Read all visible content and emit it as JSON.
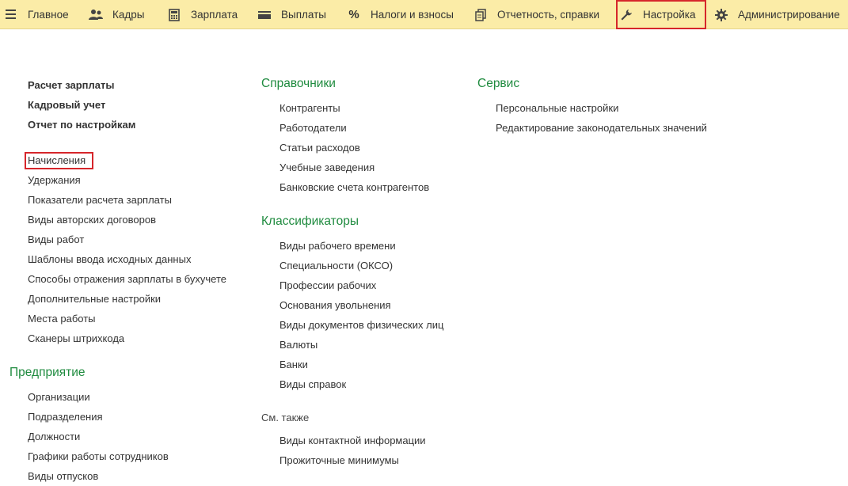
{
  "nav": {
    "items": [
      {
        "label": "Главное",
        "icon": "menu-icon"
      },
      {
        "label": "Кадры",
        "icon": "people-icon"
      },
      {
        "label": "Зарплата",
        "icon": "calculator-icon"
      },
      {
        "label": "Выплаты",
        "icon": "wallet-icon"
      },
      {
        "label": "Налоги и взносы",
        "icon": "percent-icon"
      },
      {
        "label": "Отчетность, справки",
        "icon": "documents-icon"
      },
      {
        "label": "Настройка",
        "icon": "wrench-icon",
        "active": true
      },
      {
        "label": "Администрирование",
        "icon": "gear-icon"
      }
    ]
  },
  "col1": {
    "bold_links": [
      "Расчет зарплаты",
      "Кадровый учет",
      "Отчет по настройкам"
    ],
    "links": [
      "Начисления",
      "Удержания",
      "Показатели расчета зарплаты",
      "Виды авторских договоров",
      "Виды работ",
      "Шаблоны ввода исходных данных",
      "Способы отражения зарплаты в бухучете",
      "Дополнительные настройки",
      "Места работы",
      "Сканеры штрихкода"
    ],
    "enterprise_title": "Предприятие",
    "enterprise_links": [
      "Организации",
      "Подразделения",
      "Должности",
      "Графики работы сотрудников",
      "Виды отпусков"
    ]
  },
  "col2": {
    "references_title": "Справочники",
    "references": [
      "Контрагенты",
      "Работодатели",
      "Статьи расходов",
      "Учебные заведения",
      "Банковские счета контрагентов"
    ],
    "classifiers_title": "Классификаторы",
    "classifiers": [
      "Виды рабочего времени",
      "Специальности (ОКСО)",
      "Профессии рабочих",
      "Основания увольнения",
      "Виды документов физических лиц",
      "Валюты",
      "Банки",
      "Виды справок"
    ],
    "see_also_title": "См. также",
    "see_also": [
      "Виды контактной информации",
      "Прожиточные минимумы"
    ]
  },
  "col3": {
    "service_title": "Сервис",
    "service": [
      "Персональные настройки",
      "Редактирование законодательных значений"
    ]
  },
  "colors": {
    "topbar_bg": "#fbeca7",
    "section_green": "#1f8b3f",
    "highlight_red": "#d6262b"
  }
}
